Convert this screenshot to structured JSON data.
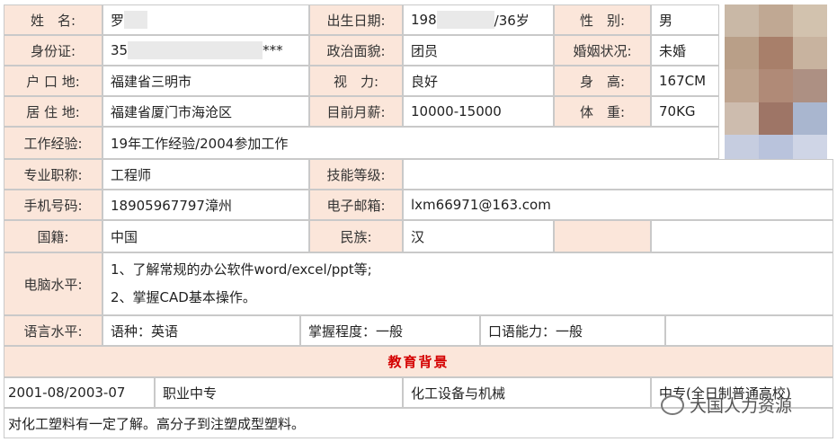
{
  "row1": {
    "name_label": "姓　名:",
    "name_value": "罗",
    "birth_label": "出生日期:",
    "birth_prefix": "198",
    "birth_suffix": "/36岁",
    "gender_label": "性　别:",
    "gender_value": "男"
  },
  "row2": {
    "id_label": "身份证:",
    "id_prefix": "35",
    "id_suffix": "***",
    "politics_label": "政治面貌:",
    "politics_value": "团员",
    "marital_label": "婚姻状况:",
    "marital_value": "未婚"
  },
  "row3": {
    "hukou_label": "户 口 地:",
    "hukou_value": "福建省三明市",
    "vision_label": "视　力:",
    "vision_value": "良好",
    "height_label": "身　高:",
    "height_value": "167CM"
  },
  "row4": {
    "residence_label": "居 住 地:",
    "residence_value": "福建省厦门市海沧区",
    "salary_label": "目前月薪:",
    "salary_value": "10000-15000",
    "weight_label": "体　重:",
    "weight_value": "70KG"
  },
  "row5": {
    "exp_label": "工作经验:",
    "exp_value": "19年工作经验/2004参加工作"
  },
  "row6": {
    "title_label": "专业职称:",
    "title_value": "工程师",
    "skill_label": "技能等级:",
    "skill_value": ""
  },
  "row7": {
    "phone_label": "手机号码:",
    "phone_value": "18905967797漳州",
    "email_label": "电子邮箱:",
    "email_value": "lxm66971@163.com"
  },
  "row8": {
    "nation_label": "国籍:",
    "nation_value": "中国",
    "ethnic_label": "民族:",
    "ethnic_value": "汉"
  },
  "computer": {
    "label": "电脑水平:",
    "line1": "1、了解常规的办公软件word/excel/ppt等;",
    "line2": "2、掌握CAD基本操作。"
  },
  "language": {
    "label": "语言水平:",
    "kind": "语种：英语",
    "mastery": "掌握程度：一般",
    "oral": "口语能力：一般"
  },
  "education": {
    "header": "教育背景",
    "period": "2001-08/2003-07",
    "school": "职业中专",
    "major": "化工设备与机械",
    "degree": "中专(全日制普通高校)"
  },
  "note": "对化工塑料有一定了解。高分子到注塑成型塑料。",
  "watermark": "大国人力资源",
  "colors": {
    "label_bg": "#fbe6da",
    "border": "#c9c9c9",
    "section_title": "#d40000"
  }
}
